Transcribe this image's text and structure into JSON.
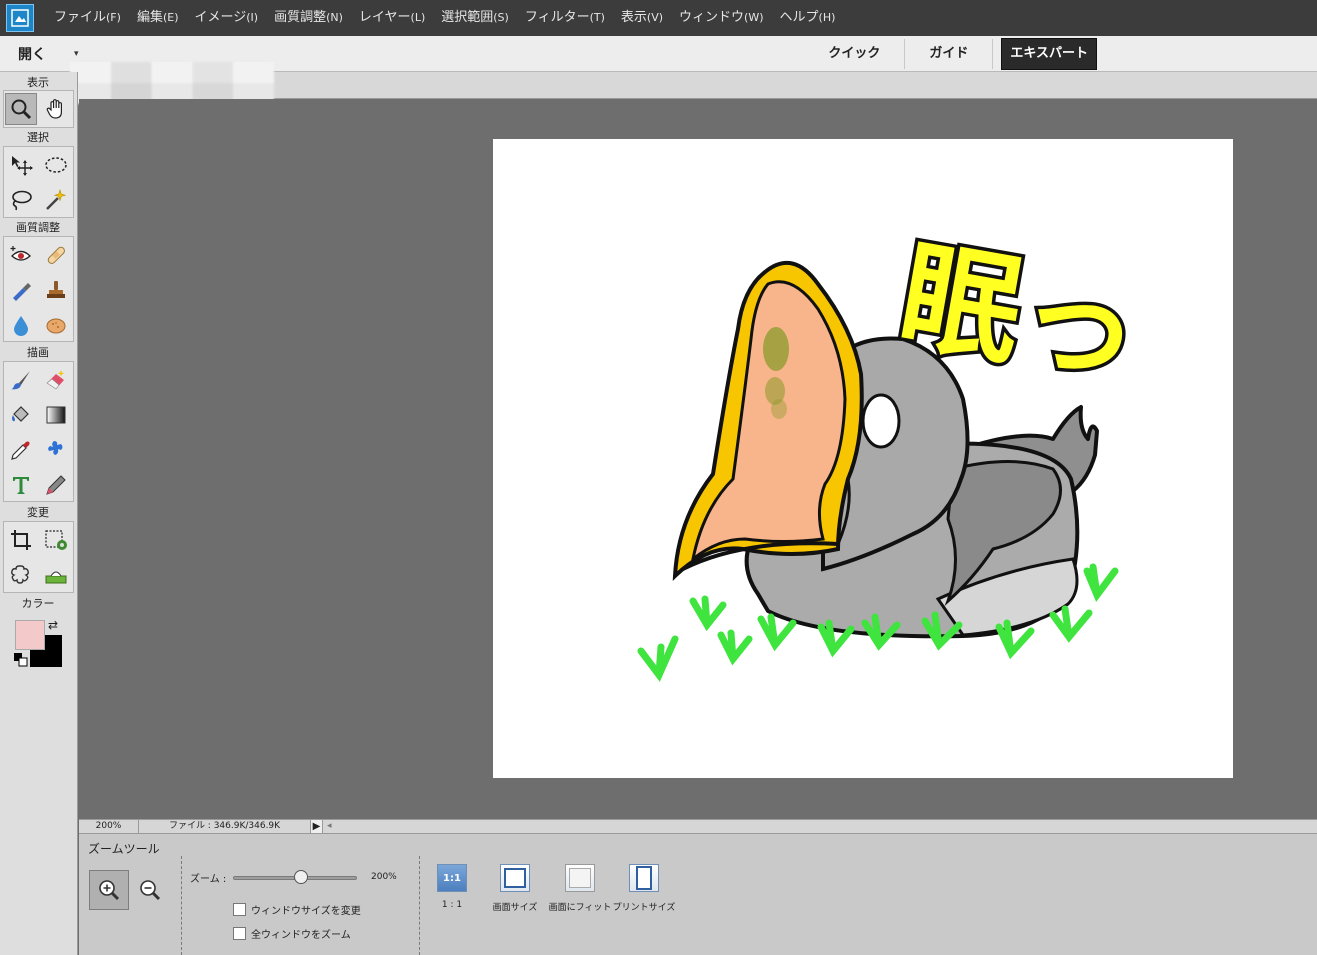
{
  "menubar": {
    "items": [
      {
        "label": "ファイル",
        "accel": "(F)"
      },
      {
        "label": "編集",
        "accel": "(E)"
      },
      {
        "label": "イメージ",
        "accel": "(I)"
      },
      {
        "label": "画質調整",
        "accel": "(N)"
      },
      {
        "label": "レイヤー",
        "accel": "(L)"
      },
      {
        "label": "選択範囲",
        "accel": "(S)"
      },
      {
        "label": "フィルター",
        "accel": "(T)"
      },
      {
        "label": "表示",
        "accel": "(V)"
      },
      {
        "label": "ウィンドウ",
        "accel": "(W)"
      },
      {
        "label": "ヘルプ",
        "accel": "(H)"
      }
    ]
  },
  "modebar": {
    "open_label": "開く",
    "open_arrow": "▾",
    "tabs": [
      {
        "label": "クイック",
        "active": false
      },
      {
        "label": "ガイド",
        "active": false
      },
      {
        "label": "エキスパート",
        "active": true
      }
    ]
  },
  "toolbox": {
    "sections": {
      "view": "表示",
      "select": "選択",
      "enhance": "画質調整",
      "draw": "描画",
      "modify": "変更",
      "color": "カラー"
    },
    "swap_glyph": "⇄"
  },
  "colors": {
    "foreground": "#f4c9c9",
    "background": "#000000",
    "accent": "#1d86c8"
  },
  "artwork": {
    "text": "眠っ"
  },
  "statusbar": {
    "zoom": "200%",
    "file_info": "ファイル : 346.9K/346.9K",
    "arrow": "▶",
    "scroll": "◂"
  },
  "options": {
    "tool_name": "ズームツール",
    "zoom_label": "ズーム :",
    "zoom_value": "200%",
    "zoom_fraction": 0.55,
    "checkbox_resize": "ウィンドウサイズを変更",
    "checkbox_zoom_all": "全ウィンドウをズーム",
    "view_buttons": [
      {
        "label": "1 : 1",
        "glyph": "1:1"
      },
      {
        "label": "画面サイズ"
      },
      {
        "label": "画面にフィット"
      },
      {
        "label": "プリントサイズ"
      }
    ]
  }
}
